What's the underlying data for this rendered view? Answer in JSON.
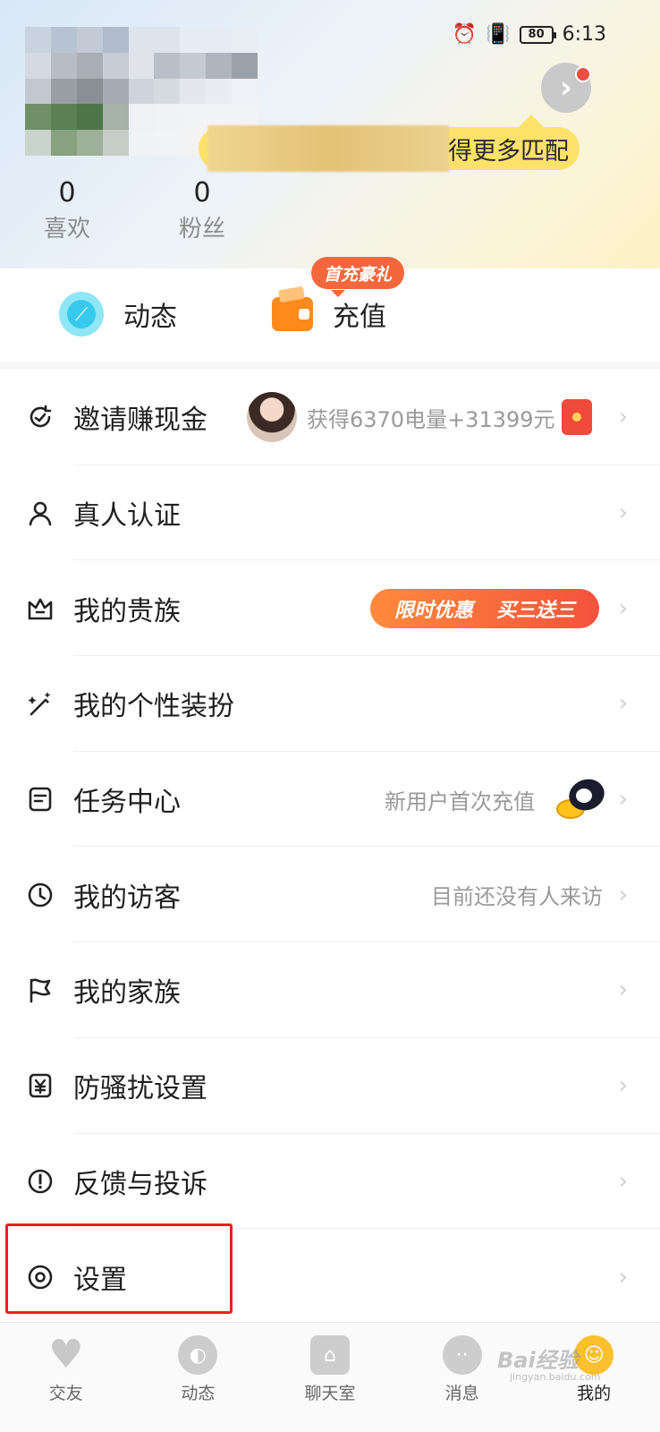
{
  "status_bar": {
    "battery": "80",
    "time": "6:13",
    "alarm_icon": "alarm-icon",
    "vibrate_icon": "vibrate-icon"
  },
  "profile": {
    "match_text": "得更多匹配",
    "stats": [
      {
        "value": "0",
        "label": "喜欢"
      },
      {
        "value": "0",
        "label": "粉丝"
      }
    ]
  },
  "quick_actions": {
    "moments": {
      "label": "动态",
      "icon": "moments-icon"
    },
    "recharge": {
      "label": "充值",
      "icon": "wallet-icon",
      "promo": "首充豪礼"
    }
  },
  "menu": [
    {
      "label": "邀请赚现金",
      "icon": "invite-icon",
      "right": "获得6370电量+31399元"
    },
    {
      "label": "真人认证",
      "icon": "person-icon",
      "right": ""
    },
    {
      "label": "我的贵族",
      "icon": "crown-icon",
      "right": "",
      "tag_left": "限时优惠",
      "tag_right": "买三送三"
    },
    {
      "label": "我的个性装扮",
      "icon": "magic-wand-icon",
      "right": ""
    },
    {
      "label": "任务中心",
      "icon": "task-icon",
      "right": "新用户首次充值"
    },
    {
      "label": "我的访客",
      "icon": "clock-icon",
      "right": "目前还没有人来访"
    },
    {
      "label": "我的家族",
      "icon": "flag-icon",
      "right": ""
    },
    {
      "label": "防骚扰设置",
      "icon": "shield-yen-icon",
      "right": ""
    },
    {
      "label": "反馈与投诉",
      "icon": "exclamation-icon",
      "right": ""
    },
    {
      "label": "设置",
      "icon": "settings-icon",
      "right": ""
    }
  ],
  "tabs": [
    {
      "label": "交友",
      "icon": "heart-icon",
      "active": false
    },
    {
      "label": "动态",
      "icon": "planet-icon",
      "active": false
    },
    {
      "label": "聊天室",
      "icon": "house-icon",
      "active": false
    },
    {
      "label": "消息",
      "icon": "chat-icon",
      "active": false
    },
    {
      "label": "我的",
      "icon": "me-icon",
      "active": true
    }
  ],
  "watermark": {
    "text": "Bai经验",
    "sub": "jingyan.baidu.com"
  },
  "colors": {
    "accent": "#fcbf2d",
    "promo": "#f4673c",
    "highlight": "#e8201c"
  }
}
